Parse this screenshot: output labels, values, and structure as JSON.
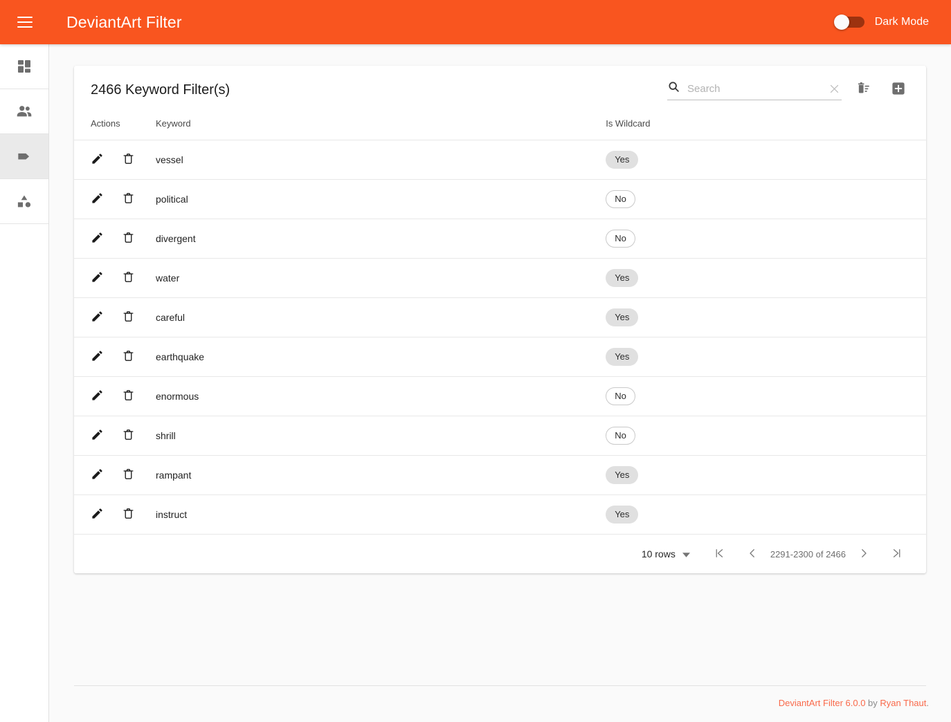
{
  "appbar": {
    "menu_icon": "hamburger-menu-icon",
    "title": "DeviantArt Filter",
    "dark_mode_label": "Dark Mode",
    "dark_mode_on": false,
    "accent_color": "#f9551f"
  },
  "sidebar": {
    "items": [
      {
        "icon": "dashboard-icon",
        "name": "dashboard",
        "active": false
      },
      {
        "icon": "users-icon",
        "name": "users",
        "active": false
      },
      {
        "icon": "tag-icon",
        "name": "keywords",
        "active": true
      },
      {
        "icon": "category-icon",
        "name": "categories",
        "active": false
      }
    ]
  },
  "card": {
    "title": "2466 Keyword Filter(s)",
    "search": {
      "value": "",
      "placeholder": "Search",
      "icon": "search-icon",
      "clear_icon": "close-icon"
    },
    "tools": [
      {
        "icon": "delete-sweep-icon",
        "name": "delete-all-button"
      },
      {
        "icon": "add-box-icon",
        "name": "add-filter-button"
      }
    ]
  },
  "table": {
    "columns": [
      "Actions",
      "Keyword",
      "Is Wildcard"
    ],
    "rows": [
      {
        "keyword": "vessel",
        "is_wildcard": "Yes"
      },
      {
        "keyword": "political",
        "is_wildcard": "No"
      },
      {
        "keyword": "divergent",
        "is_wildcard": "No"
      },
      {
        "keyword": "water",
        "is_wildcard": "Yes"
      },
      {
        "keyword": "careful",
        "is_wildcard": "Yes"
      },
      {
        "keyword": "earthquake",
        "is_wildcard": "Yes"
      },
      {
        "keyword": "enormous",
        "is_wildcard": "No"
      },
      {
        "keyword": "shrill",
        "is_wildcard": "No"
      },
      {
        "keyword": "rampant",
        "is_wildcard": "Yes"
      },
      {
        "keyword": "instruct",
        "is_wildcard": "Yes"
      }
    ],
    "row_actions": [
      {
        "icon": "edit-pencil-icon",
        "name": "edit-row-button"
      },
      {
        "icon": "delete-trash-icon",
        "name": "delete-row-button"
      }
    ]
  },
  "paginator": {
    "rows_per_page_label": "10 rows",
    "range_label": "2291-2300 of 2466",
    "first_page_icon": "first-page-icon",
    "prev_page_icon": "chevron-left-icon",
    "next_page_icon": "chevron-right-icon",
    "last_page_icon": "last-page-icon",
    "dropdown_icon": "chevron-down-icon"
  },
  "footer": {
    "app_link": "DeviantArt Filter 6.0.0",
    "by_text": " by ",
    "author_link": "Ryan Thaut",
    "period": ".",
    "link_color": "#f9694a"
  }
}
